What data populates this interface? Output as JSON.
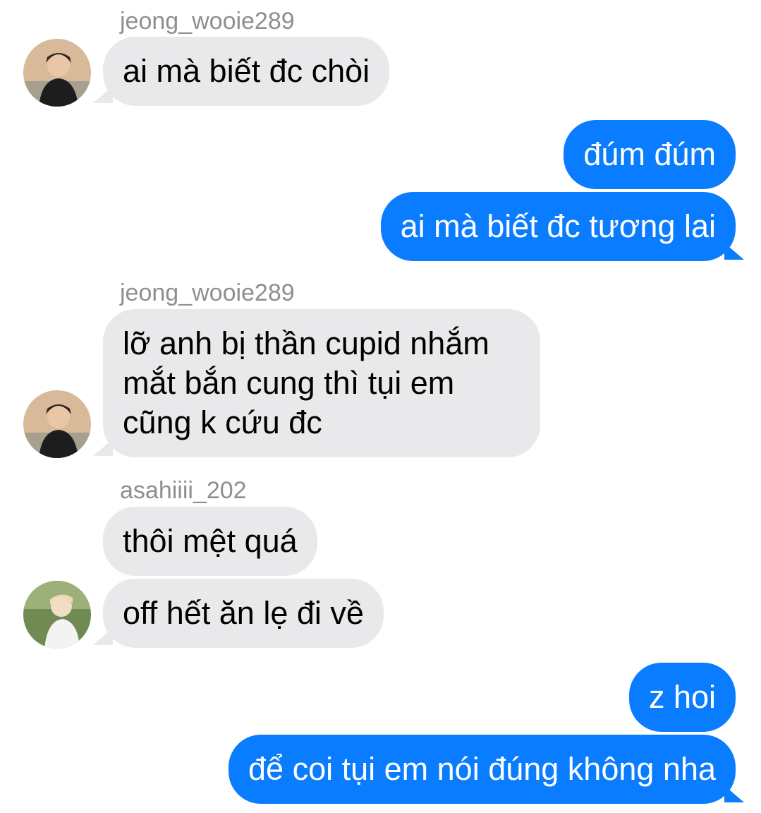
{
  "colors": {
    "incoming_bubble": "#e9e9eb",
    "outgoing_bubble": "#0a7cff",
    "sender_name": "#8e8e93"
  },
  "messages": [
    {
      "sender": "jeong_wooie289",
      "text": "ai mà biết đc chòi",
      "direction": "incoming"
    },
    {
      "text": "đúm đúm",
      "direction": "outgoing"
    },
    {
      "text": "ai mà biết đc tương lai",
      "direction": "outgoing"
    },
    {
      "sender": "jeong_wooie289",
      "lines": [
        "lỡ anh bị thần cupid nhắm",
        "mắt bắn cung thì tụi em",
        "cũng k cứu đc"
      ],
      "direction": "incoming"
    },
    {
      "sender": "asahiiii_202",
      "text": "thôi mệt quá",
      "direction": "incoming"
    },
    {
      "text": "off hết ăn lẹ đi về",
      "direction": "incoming"
    },
    {
      "text": "z hoi",
      "direction": "outgoing"
    },
    {
      "text": "để coi tụi em nói đúng không nha",
      "direction": "outgoing"
    }
  ],
  "avatars": [
    {
      "icon": "profile-photo-jeong-wooie289"
    },
    {
      "icon": "profile-photo-jeong-wooie289"
    },
    {
      "icon": "profile-photo-asahiiii-202"
    }
  ]
}
